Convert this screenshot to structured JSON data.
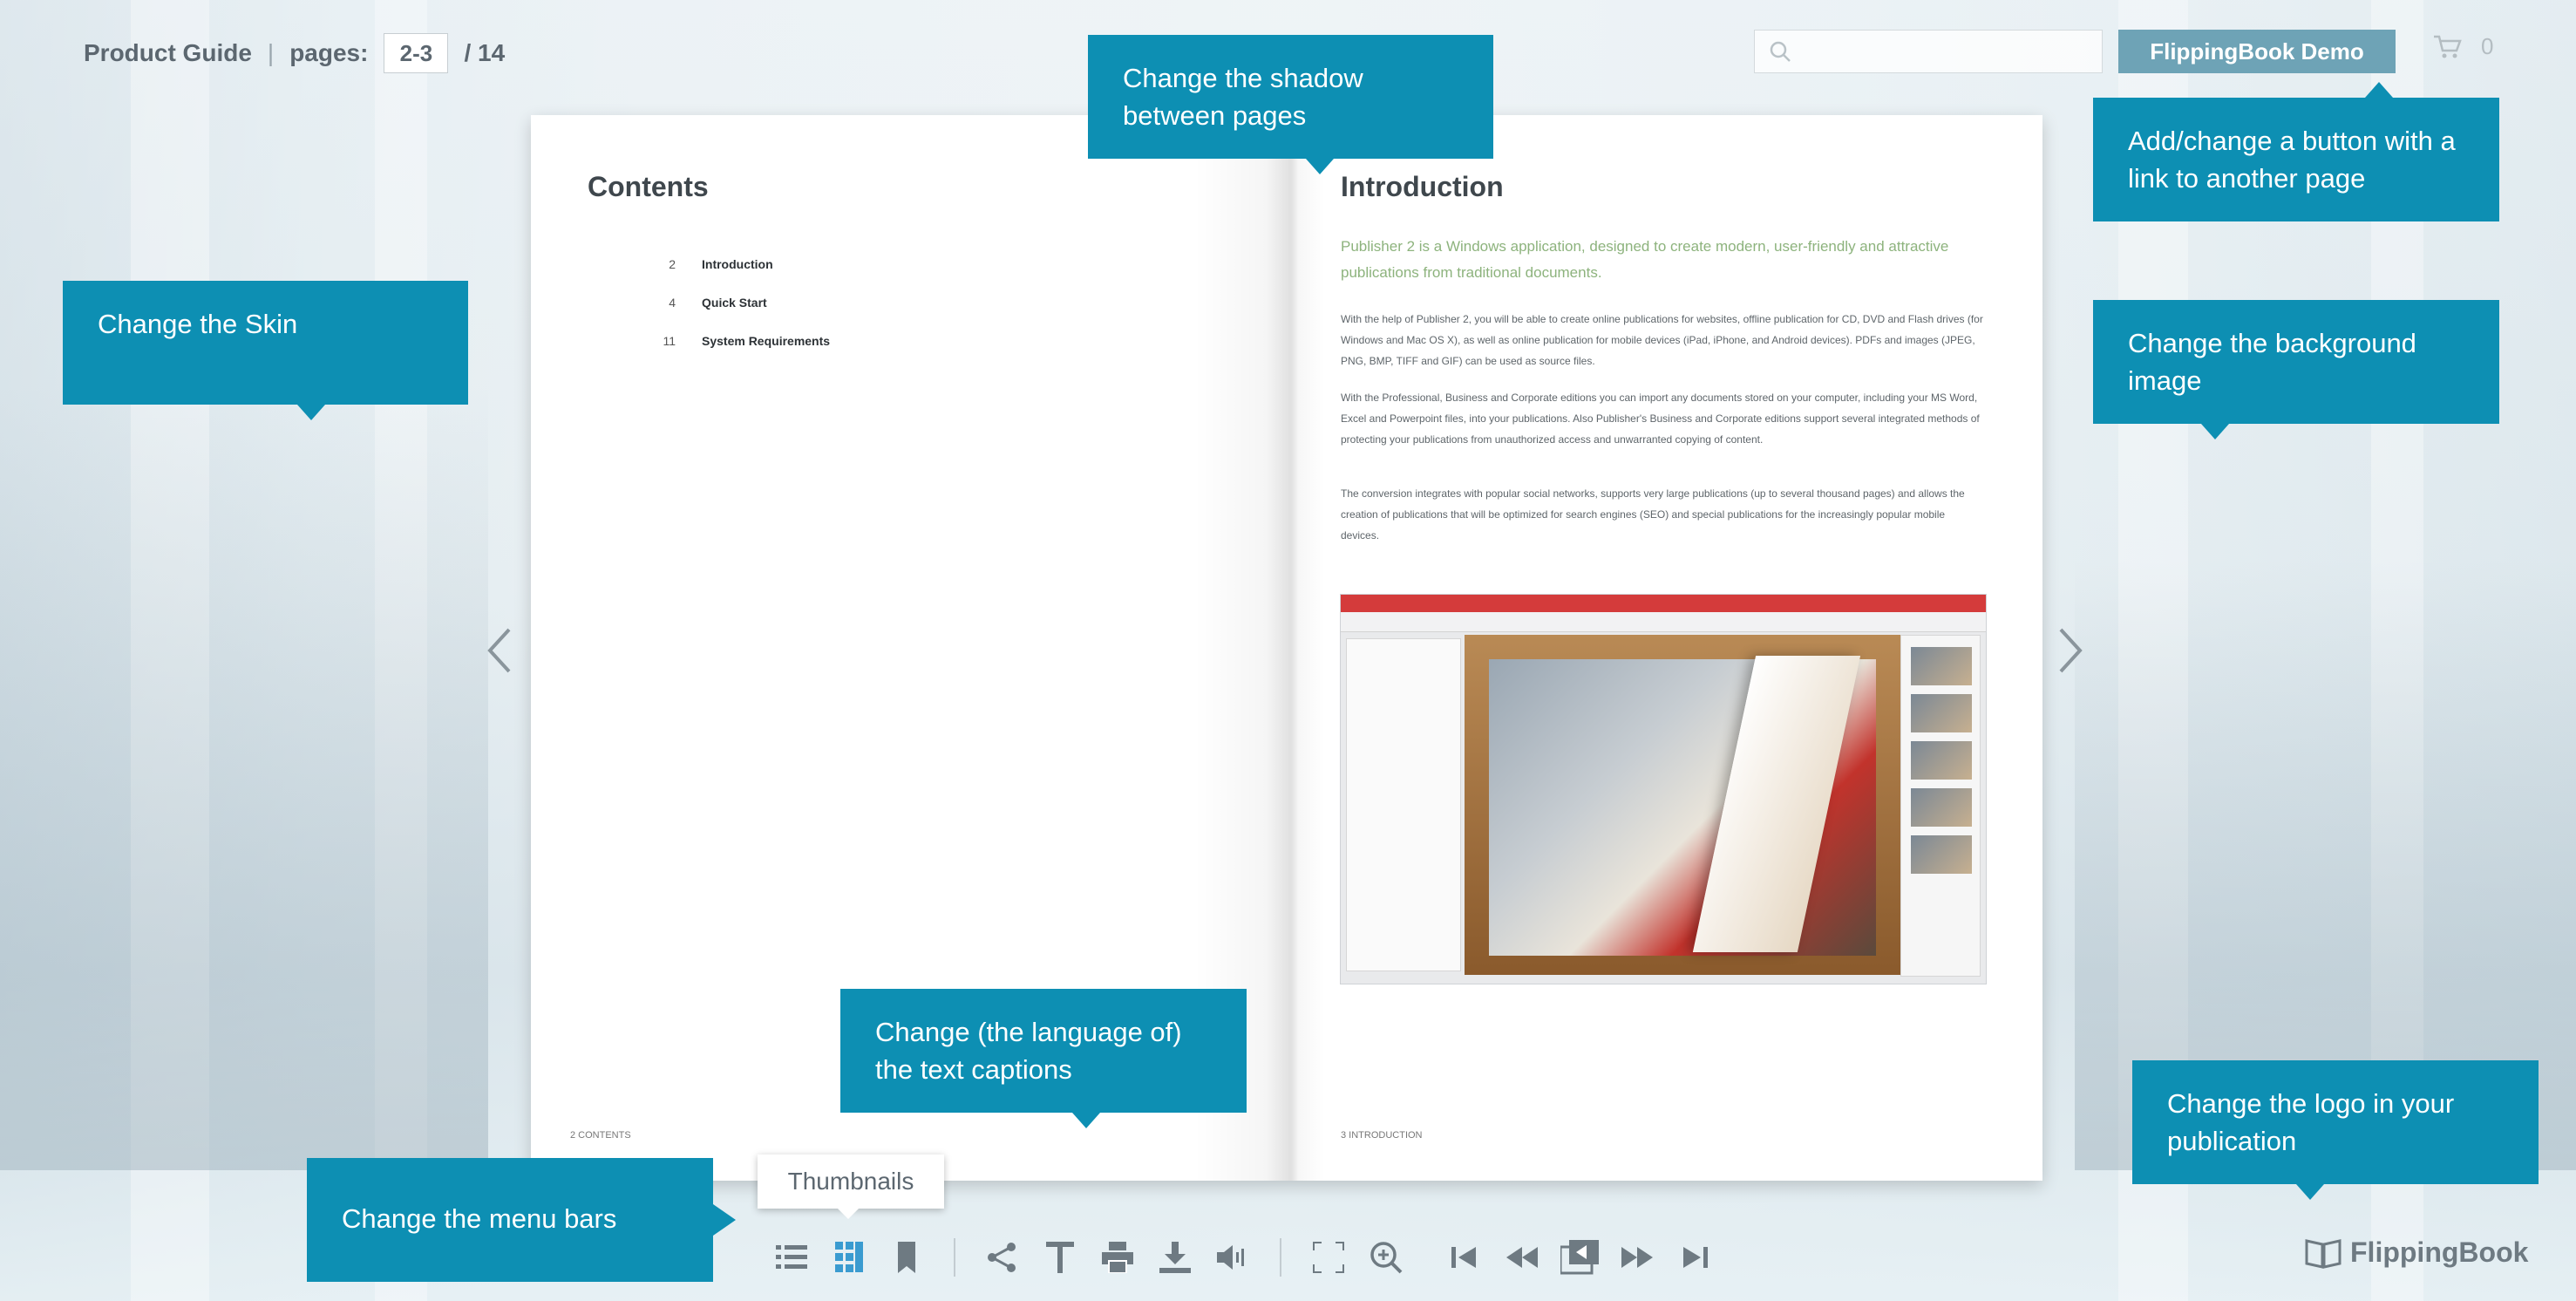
{
  "header": {
    "title": "Product Guide",
    "separator": "|",
    "pages_label": "pages:",
    "page_value": "2-3",
    "total_pages": "/ 14"
  },
  "search": {
    "placeholder": ""
  },
  "demo_button": {
    "label": "FlippingBook Demo"
  },
  "cart": {
    "count": "0"
  },
  "left_page": {
    "title": "Contents",
    "toc": [
      {
        "num": "2",
        "label": "Introduction"
      },
      {
        "num": "4",
        "label": "Quick Start"
      },
      {
        "num": "11",
        "label": "System Requirements"
      }
    ],
    "footer": "2 CONTENTS"
  },
  "right_page": {
    "title": "Introduction",
    "lead": "Publisher 2 is a Windows application, designed to create modern, user-friendly and attractive publications from traditional documents.",
    "paragraphs": [
      "With the help of Publisher 2, you will be able to create online publications for websites, offline publication for CD, DVD and Flash drives (for Windows and Mac OS X), as well as online publication for mobile devices (iPad, iPhone, and Android devices). PDFs and images (JPEG, PNG, BMP, TIFF and GIF) can be used as source files.",
      "With the Professional, Business and Corporate editions you can import any documents stored on your computer, including your MS Word, Excel and Powerpoint files, into your publications. Also Publisher's Business and Corporate editions support several integrated methods of protecting your publications from unauthorized access and unwarranted copying of content.",
      "The conversion integrates with popular social networks, supports very large publications (up to several thousand pages) and allows the creation of publications that will be optimized for search engines (SEO) and special publications for the increasingly popular mobile devices."
    ],
    "footer": "3 INTRODUCTION"
  },
  "callouts": {
    "shadow": "Change the shadow between pages",
    "button_link": "Add/change a button with a link to another page",
    "skin": "Change the Skin",
    "background": "Change the background image",
    "captions": "Change (the language of) the text captions",
    "logo": "Change the logo in your publication",
    "menu_bars": "Change the menu bars"
  },
  "tooltip": {
    "label": "Thumbnails"
  },
  "toolbar": {
    "groups": [
      [
        "list-icon",
        "thumbnails-icon",
        "bookmark-icon"
      ],
      [
        "share-icon",
        "text-icon",
        "print-icon",
        "download-icon",
        "sound-icon"
      ],
      [
        "fullscreen-icon",
        "zoom-icon",
        "first-page-icon",
        "previous-page-icon",
        "page-flip-icon",
        "next-page-icon",
        "last-page-icon"
      ]
    ],
    "active": "thumbnails-icon"
  },
  "logo": {
    "label": "FlippingBook"
  },
  "colors": {
    "callout": "#0d8fb3",
    "toolbar_icon": "#6e7a82",
    "toolbar_active": "#3a9bd0",
    "demo_button": "#6ea3b6",
    "lead_text": "#8db37d"
  }
}
